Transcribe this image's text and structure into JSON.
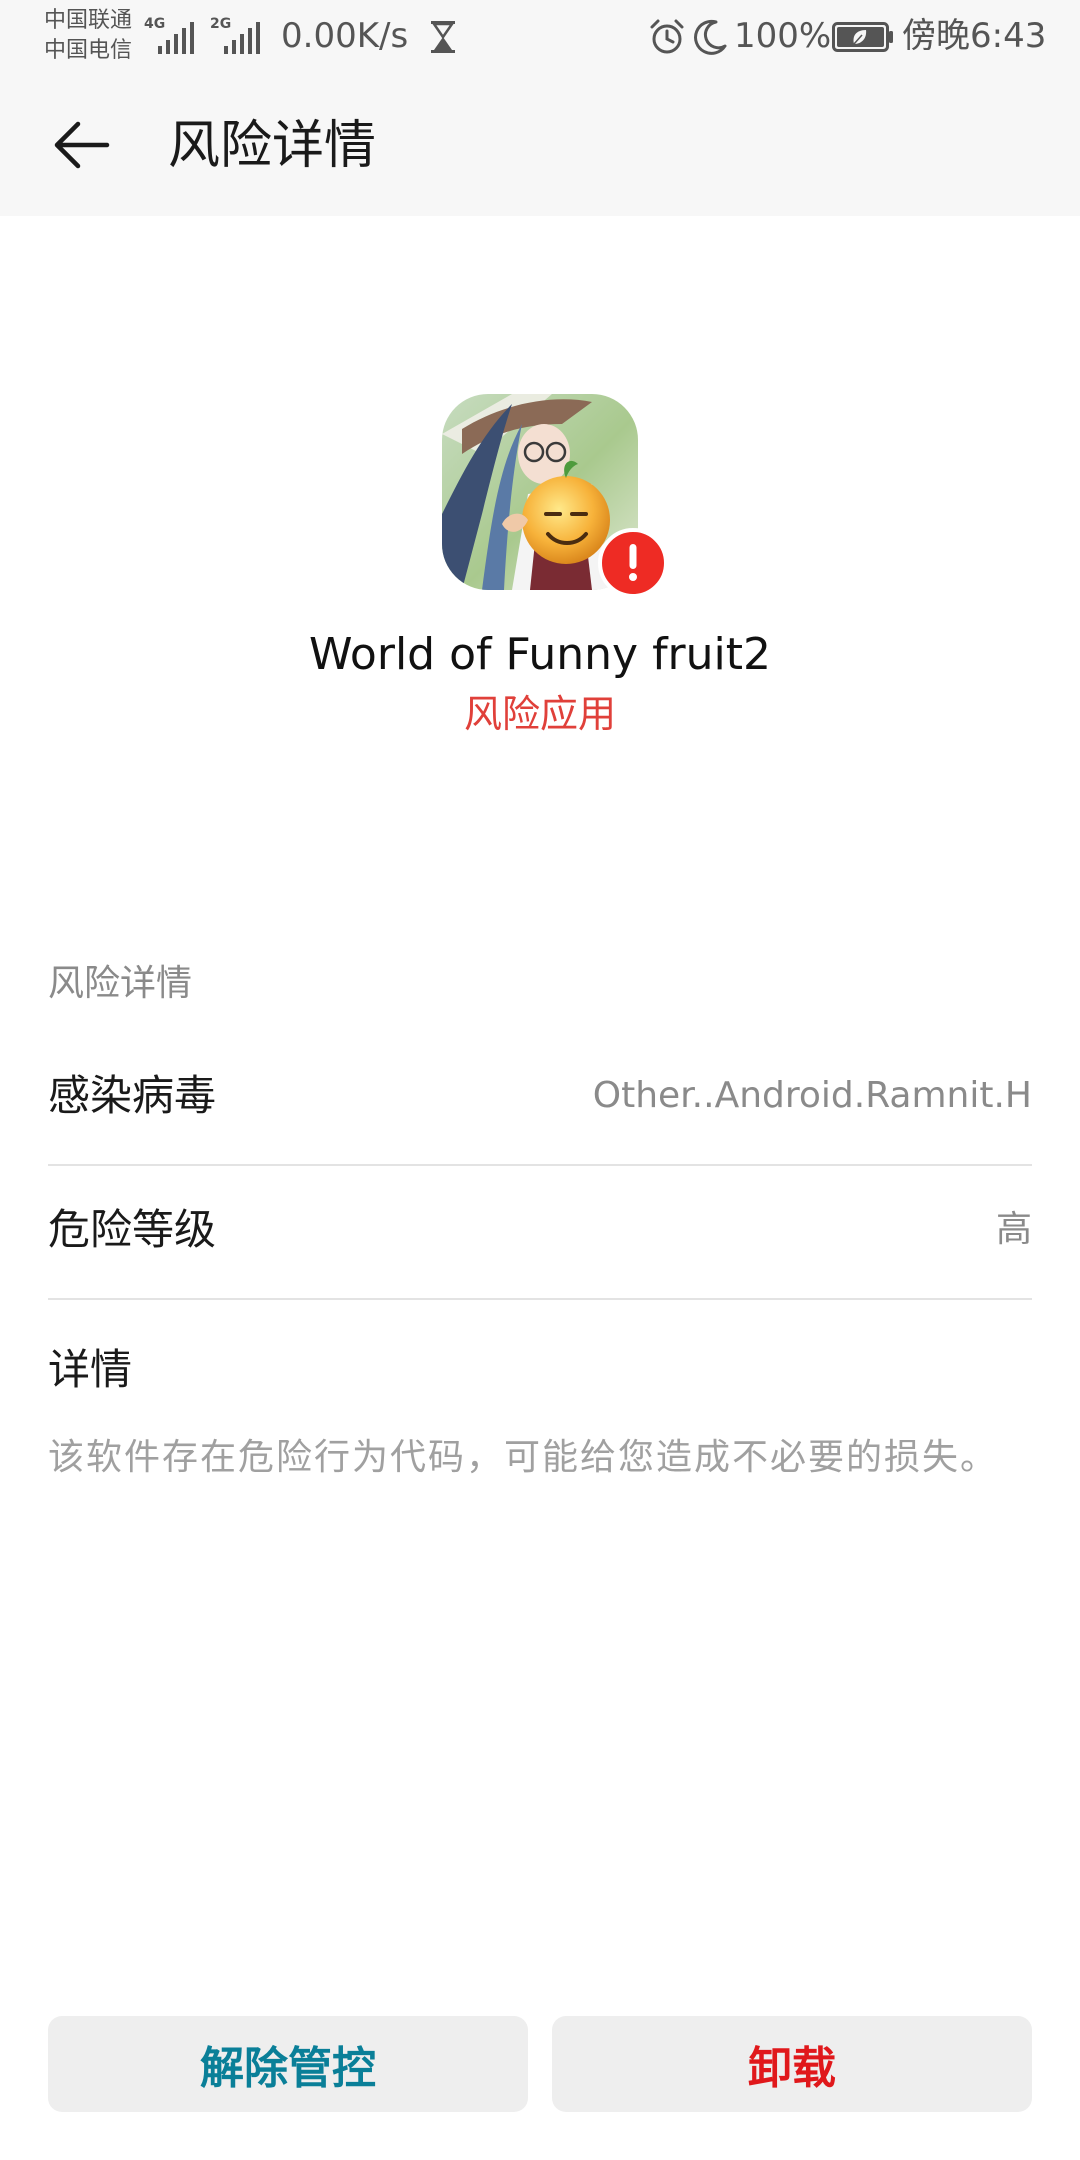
{
  "status_bar": {
    "carrier_1": "中国联通",
    "carrier_2": "中国电信",
    "sim1_network": "4G",
    "sim2_network": "2G",
    "net_speed": "0.00K/s",
    "battery_pct": "100%",
    "time": "傍晚6:43",
    "icons": [
      "signal-icon",
      "hourglass-icon",
      "alarm-icon",
      "moon-icon",
      "battery-icon"
    ]
  },
  "app_bar": {
    "title": "风险详情",
    "back_icon": "arrow-left-icon"
  },
  "app": {
    "name": "World of Funny fruit2",
    "status": "风险应用",
    "badge_icon": "exclamation-icon"
  },
  "details": {
    "section_title": "风险详情",
    "virus_label": "感染病毒",
    "virus_value": "Other..Android.Ramnit.H",
    "level_label": "危险等级",
    "level_value": "高",
    "info_label": "详情",
    "info_text": "该软件存在危险行为代码，可能给您造成不必要的损失。"
  },
  "actions": {
    "release": "解除管控",
    "uninstall": "卸载"
  },
  "colors": {
    "danger": "#e0403a",
    "uninstall_text": "#e0181b",
    "release_text": "#0a7f98",
    "badge": "#ee2b24"
  }
}
